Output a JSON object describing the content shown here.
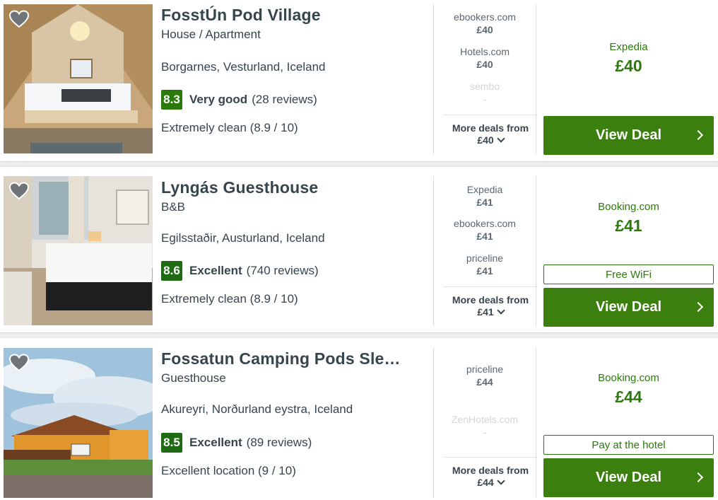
{
  "colors": {
    "green": "#2b7a0b",
    "button": "#3b7f0f",
    "text": "#37454d",
    "muted": "#5b6770"
  },
  "listings": [
    {
      "name": "FosstÚn Pod Village",
      "type": "House / Apartment",
      "location": "Borgarnes, Vesturland, Iceland",
      "score": "8.3",
      "rating_word": "Very good",
      "reviews": "(28 reviews)",
      "subrating": "Extremely clean (8.9 / 10)",
      "deals": [
        {
          "site": "ebookers.com",
          "price": "£40"
        },
        {
          "site": "Hotels.com",
          "price": "£40"
        },
        {
          "site": "sembo",
          "price": "-"
        }
      ],
      "more_label": "More deals from",
      "more_price": "£40",
      "best_site": "Expedia",
      "best_price": "£40",
      "view_label": "View Deal",
      "icons": {
        "favorite": "heart-icon",
        "more": "chevron-down-icon",
        "view": "chevron-right-icon"
      }
    },
    {
      "name": "Lyngás Guesthouse",
      "type": "B&B",
      "location": "Egilsstaðir, Austurland, Iceland",
      "score": "8.6",
      "rating_word": "Excellent",
      "reviews": "(740 reviews)",
      "subrating": "Extremely clean (8.9 / 10)",
      "deals": [
        {
          "site": "Expedia",
          "price": "£41"
        },
        {
          "site": "ebookers.com",
          "price": "£41"
        },
        {
          "site": "priceline",
          "price": "£41"
        }
      ],
      "more_label": "More deals from",
      "more_price": "£41",
      "best_site": "Booking.com",
      "best_price": "£41",
      "tag": "Free WiFi",
      "view_label": "View Deal"
    },
    {
      "name": "Fossatun Camping Pods Sle…",
      "type": "Guesthouse",
      "location": "Akureyri, Norðurland eystra, Iceland",
      "score": "8.5",
      "rating_word": "Excellent",
      "reviews": "(89 reviews)",
      "subrating": "Excellent location (9 / 10)",
      "deals": [
        {
          "site": "priceline",
          "price": "£44"
        },
        {
          "site": "ZenHotels.com",
          "price": "-"
        }
      ],
      "more_label": "More deals from",
      "more_price": "£44",
      "best_site": "Booking.com",
      "best_price": "£44",
      "tag": "Pay at the hotel",
      "view_label": "View Deal"
    }
  ]
}
